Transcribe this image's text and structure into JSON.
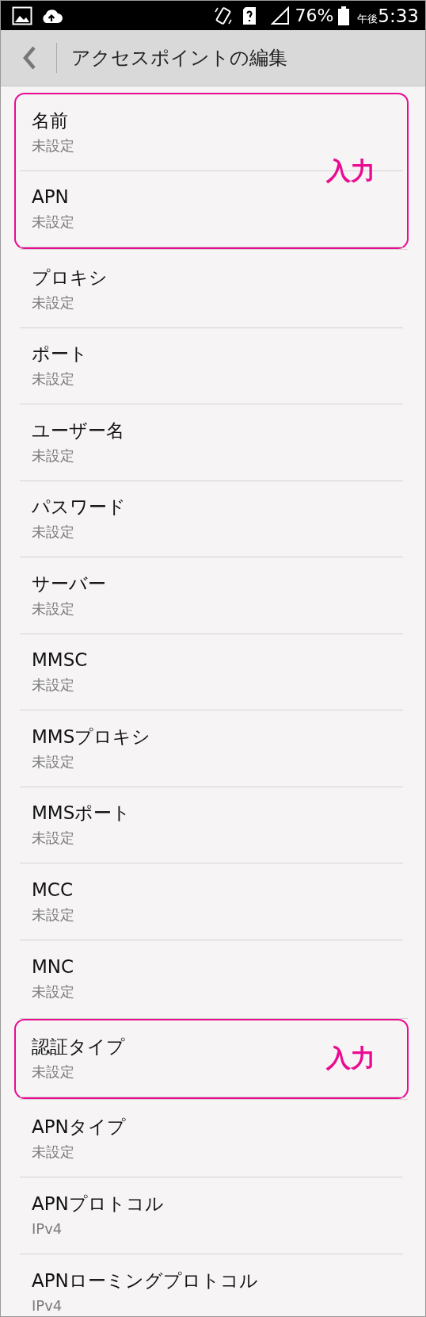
{
  "status_bar": {
    "battery": "76%",
    "time_period": "午後",
    "time": "5:33"
  },
  "header": {
    "title": "アクセスポイントの編集"
  },
  "groups": [
    {
      "highlighted": true,
      "annotation": "入力",
      "items": [
        {
          "title": "名前",
          "value": "未設定"
        },
        {
          "title": "APN",
          "value": "未設定"
        }
      ]
    },
    {
      "highlighted": false,
      "items": [
        {
          "title": "プロキシ",
          "value": "未設定"
        },
        {
          "title": "ポート",
          "value": "未設定"
        },
        {
          "title": "ユーザー名",
          "value": "未設定"
        },
        {
          "title": "パスワード",
          "value": "未設定"
        },
        {
          "title": "サーバー",
          "value": "未設定"
        },
        {
          "title": "MMSC",
          "value": "未設定"
        },
        {
          "title": "MMSプロキシ",
          "value": "未設定"
        },
        {
          "title": "MMSポート",
          "value": "未設定"
        },
        {
          "title": "MCC",
          "value": "未設定"
        },
        {
          "title": "MNC",
          "value": "未設定"
        }
      ]
    },
    {
      "highlighted": true,
      "annotation": "入力",
      "items": [
        {
          "title": "認証タイプ",
          "value": "未設定"
        }
      ]
    },
    {
      "highlighted": false,
      "items": [
        {
          "title": "APNタイプ",
          "value": "未設定"
        },
        {
          "title": "APNプロトコル",
          "value": "IPv4"
        },
        {
          "title": "APNローミングプロトコル",
          "value": "IPv4"
        }
      ]
    }
  ]
}
